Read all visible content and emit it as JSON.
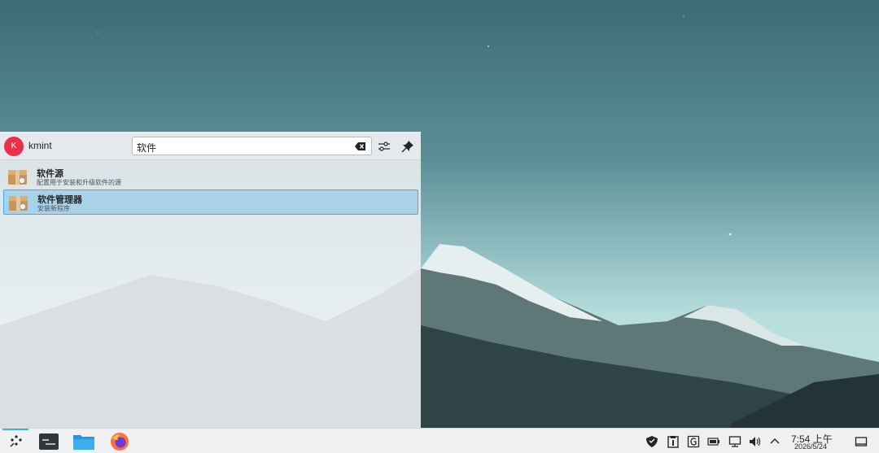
{
  "launcher": {
    "avatar_letter": "K",
    "username": "kmint",
    "search_value": "软件",
    "results": [
      {
        "title": "软件源",
        "subtitle": "配置用于安装和升级软件的源"
      },
      {
        "title": "软件管理器",
        "subtitle": "安装新程序"
      }
    ]
  },
  "taskbar": {
    "clock_time": "7:54 上午",
    "clock_date": "2026/5/24"
  },
  "colors": {
    "accent": "#3daee9",
    "selection": "#a9d2e8",
    "avatar": "#e8304a"
  },
  "icons": [
    "clear-search-icon",
    "configure-icon",
    "pin-icon",
    "package-icon",
    "app-launcher-icon",
    "terminal-icon",
    "file-manager-icon",
    "firefox-icon",
    "shield-icon",
    "clipboard-icon",
    "input-method-icon",
    "battery-icon",
    "network-icon",
    "volume-icon",
    "expand-tray-icon",
    "show-desktop-icon"
  ]
}
